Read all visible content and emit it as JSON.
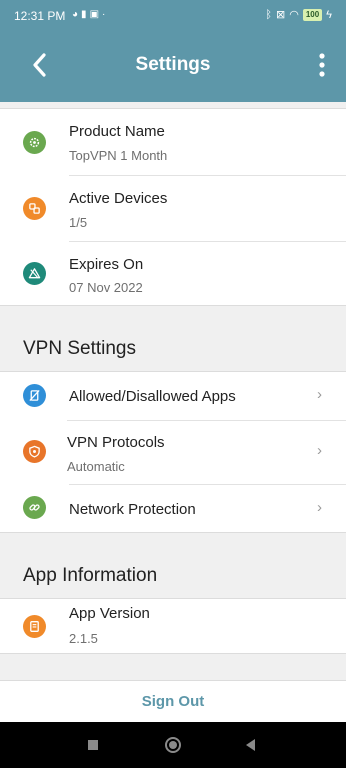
{
  "status_bar": {
    "time": "12:31 PM",
    "left_icons": [
      "pinwheel-icon",
      "trash-icon",
      "upload-icon",
      "dot-icon"
    ],
    "right_icons": [
      "bluetooth-icon",
      "sim-off-icon",
      "wifi-icon"
    ],
    "battery": "100"
  },
  "header": {
    "title": "Settings"
  },
  "account": {
    "items": [
      {
        "title": "Product Name",
        "subtitle": "TopVPN 1 Month",
        "icon": "gear-badge-icon",
        "color": "#6aa84f"
      },
      {
        "title": "Active Devices",
        "subtitle": "1/5",
        "icon": "devices-icon",
        "color": "#f08a2a"
      },
      {
        "title": "Expires On",
        "subtitle": "07 Nov 2022",
        "icon": "expiry-icon",
        "color": "#1f8a7a"
      }
    ]
  },
  "vpn_settings": {
    "heading": "VPN Settings",
    "items": [
      {
        "title": "Allowed/Disallowed Apps",
        "subtitle": "",
        "icon": "apps-icon",
        "color": "#2f8fd8"
      },
      {
        "title": "VPN Protocols",
        "subtitle": "Automatic",
        "icon": "shield-icon",
        "color": "#e8752a"
      },
      {
        "title": "Network Protection",
        "subtitle": "",
        "icon": "link-icon",
        "color": "#6aa84f"
      }
    ]
  },
  "app_info": {
    "heading": "App Information",
    "items": [
      {
        "title": "App Version",
        "subtitle": "2.1.5",
        "icon": "document-icon",
        "color": "#f08a2a"
      }
    ]
  },
  "sign_out_label": "Sign Out",
  "colors": {
    "accent": "#5d97a9",
    "background": "#f0f0f0"
  }
}
